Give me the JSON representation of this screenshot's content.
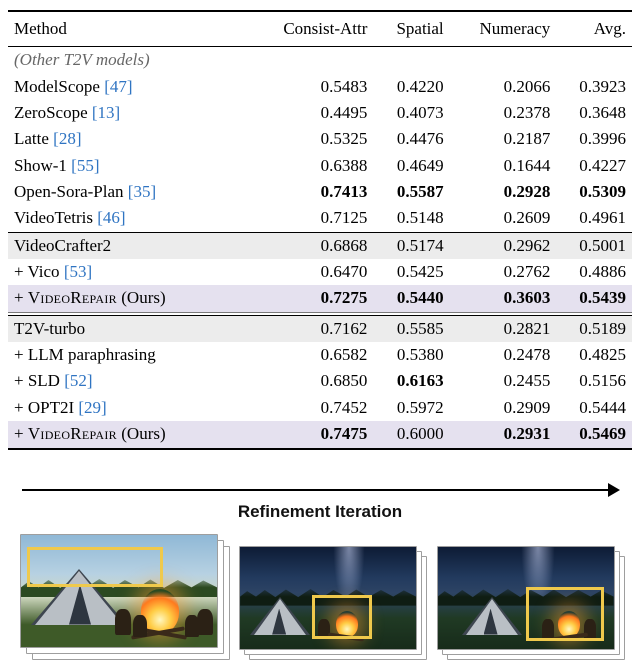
{
  "table": {
    "headers": [
      "Method",
      "Consist-Attr",
      "Spatial",
      "Numeracy",
      "Avg."
    ],
    "section1_label": "(Other T2V models)",
    "rows_other": [
      {
        "method": "ModelScope",
        "cite": "[47]",
        "ca": "0.5483",
        "sp": "0.4220",
        "nu": "0.2066",
        "av": "0.3923"
      },
      {
        "method": "ZeroScope",
        "cite": "[13]",
        "ca": "0.4495",
        "sp": "0.4073",
        "nu": "0.2378",
        "av": "0.3648"
      },
      {
        "method": "Latte",
        "cite": "[28]",
        "ca": "0.5325",
        "sp": "0.4476",
        "nu": "0.2187",
        "av": "0.3996"
      },
      {
        "method": "Show-1",
        "cite": "[55]",
        "ca": "0.6388",
        "sp": "0.4649",
        "nu": "0.1644",
        "av": "0.4227"
      },
      {
        "method": "Open-Sora-Plan",
        "cite": "[35]",
        "ca": "0.7413",
        "sp": "0.5587",
        "nu": "0.2928",
        "av": "0.5309",
        "bold_all": true
      },
      {
        "method": "VideoTetris",
        "cite": "[46]",
        "ca": "0.7125",
        "sp": "0.5148",
        "nu": "0.2609",
        "av": "0.4961"
      }
    ],
    "group_vc": {
      "base_name": "VideoCrafter2",
      "base": {
        "ca": "0.6868",
        "sp": "0.5174",
        "nu": "0.2962",
        "av": "0.5001"
      },
      "vico": {
        "prefix": "+ Vico",
        "cite": "[53]",
        "ca": "0.6470",
        "sp": "0.5425",
        "nu": "0.2762",
        "av": "0.4886"
      },
      "ours": {
        "prefix": "+ ",
        "name": "VideoRepair",
        "suffix": " (Ours)",
        "ca": "0.7275",
        "sp": "0.5440",
        "nu": "0.3603",
        "av": "0.5439"
      }
    },
    "group_t2v": {
      "base_name": "T2V-turbo",
      "base": {
        "ca": "0.7162",
        "sp": "0.5585",
        "nu": "0.2821",
        "av": "0.5189"
      },
      "llm": {
        "label": "+ LLM paraphrasing",
        "ca": "0.6582",
        "sp": "0.5380",
        "nu": "0.2478",
        "av": "0.4825"
      },
      "sld": {
        "prefix": "+ SLD",
        "cite": "[52]",
        "ca": "0.6850",
        "sp": "0.6163",
        "nu": "0.2455",
        "av": "0.5156",
        "bold_sp": true
      },
      "opt": {
        "prefix": "+ OPT2I",
        "cite": "[29]",
        "ca": "0.7452",
        "sp": "0.5972",
        "nu": "0.2909",
        "av": "0.5444"
      },
      "ours": {
        "prefix": "+ ",
        "name": "VideoRepair",
        "suffix": " (Ours)",
        "ca": "0.7475",
        "sp": "0.6000",
        "nu": "0.2931",
        "av": "0.5469"
      }
    }
  },
  "figure": {
    "label": "Refinement Iteration"
  }
}
